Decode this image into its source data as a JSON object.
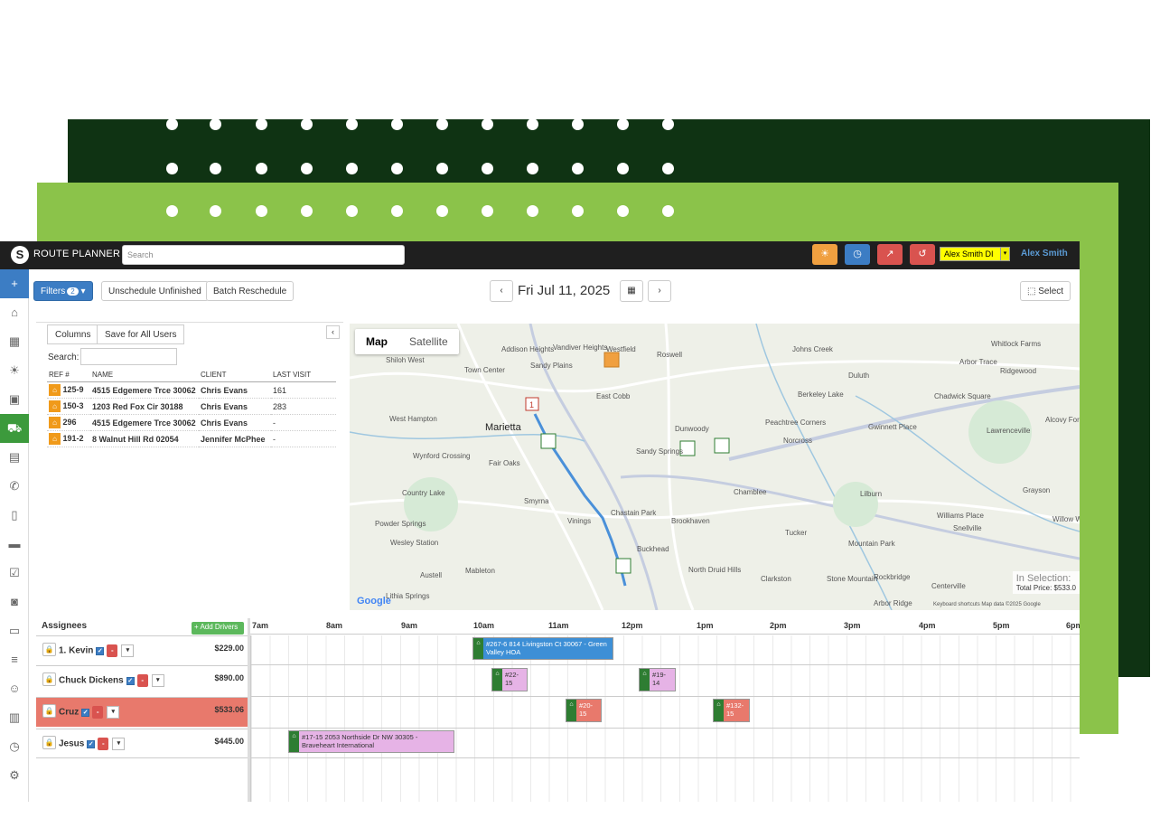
{
  "topbar": {
    "title": "ROUTE PLANNER",
    "search_placeholder": "Search",
    "user_select": "Alex Smith DI",
    "user_name": "Alex Smith",
    "buttons": [
      {
        "icon": "sun-icon",
        "color": "#f0a040"
      },
      {
        "icon": "clock-icon",
        "color": "#3c7dc4"
      },
      {
        "icon": "chart-line-icon",
        "color": "#d9534f"
      },
      {
        "icon": "history-icon",
        "color": "#d9534f"
      }
    ]
  },
  "toolbar": {
    "filters_label": "Filters",
    "filters_count": "2",
    "unschedule_label": "Unschedule Unfinished",
    "batch_label": "Batch Reschedule",
    "date": "Fri Jul 11, 2025",
    "select_label": "Select"
  },
  "jobs_panel": {
    "columns_label": "Columns",
    "save_label": "Save for All Users",
    "search_label": "Search:",
    "headers": [
      "REF #",
      "NAME",
      "CLIENT",
      "LAST VISIT"
    ],
    "rows": [
      {
        "ref": "125-9",
        "name": "4515 Edgemere Trce 30062",
        "client": "Chris Evans",
        "last": "161"
      },
      {
        "ref": "150-3",
        "name": "1203 Red Fox Cir 30188",
        "client": "Chris Evans",
        "last": "283"
      },
      {
        "ref": "296",
        "name": "4515 Edgemere Trce 30062",
        "client": "Chris Evans",
        "last": "-"
      },
      {
        "ref": "191-2",
        "name": "8 Walnut Hill Rd 02054",
        "client": "Jennifer McPhee",
        "last": "-"
      }
    ]
  },
  "map": {
    "tab_map": "Map",
    "tab_satellite": "Satellite",
    "in_selection": "In Selection:",
    "total_price": "Total Price: $533.0",
    "brand": "Google",
    "attribution": "Keyboard shortcuts   Map data ©2025 Google",
    "labels": [
      "Shiloh West",
      "Vandiver Heights",
      "Sandy Plains",
      "Westfield",
      "Roswell",
      "Johns Creek",
      "Whitlock Farms",
      "Arbor Trace",
      "Ridgewood",
      "Duluth",
      "East Cobb",
      "Berkeley Lake",
      "Chadwick Square",
      "West Hampton",
      "Marietta",
      "Dunwoody",
      "Peachtree Corners",
      "Gwinnett Place",
      "Lawrenceville",
      "Wynford Crossing",
      "Fair Oaks",
      "Sandy Springs",
      "Norcross",
      "Country Lake",
      "Smyrna",
      "Chamblee",
      "Lilburn",
      "Grayson",
      "Vinings",
      "Chastain Park",
      "Brookhaven",
      "Williams Place",
      "Powder Springs",
      "Wesley Station",
      "Tucker",
      "Mountain Park",
      "Snellville",
      "Mableton",
      "Buckhead",
      "North Druid Hills",
      "Austell",
      "Clarkston",
      "Stone Mountain",
      "Rockbridge",
      "Lithia Springs",
      "Centerville",
      "Arbor Ridge",
      "Town Center",
      "Addison Heights",
      "Alcovy Forest",
      "Willow Way"
    ]
  },
  "schedule": {
    "assignees_label": "Assignees",
    "add_drivers_label": "+ Add Drivers",
    "hours": [
      "7am",
      "8am",
      "9am",
      "10am",
      "11am",
      "12pm",
      "1pm",
      "2pm",
      "3pm",
      "4pm",
      "5pm",
      "6pm"
    ],
    "assignees": [
      {
        "name": "1. Kevin",
        "price": "$229.00"
      },
      {
        "name": "Chuck Dickens",
        "price": "$890.00"
      },
      {
        "name": "Cruz",
        "price": "$533.06"
      },
      {
        "name": "Jesus",
        "price": "$445.00"
      }
    ],
    "jobs": [
      {
        "text": "#267-6 814 Livingston Ct 30067 - Green Valley HOA"
      },
      {
        "text": "#22-15"
      },
      {
        "text": "#19-14"
      },
      {
        "text": "#20-15"
      },
      {
        "text": "#132-15"
      },
      {
        "text": "#17-15 2053 Northside Dr NW 30305 - Braveheart International"
      }
    ]
  }
}
